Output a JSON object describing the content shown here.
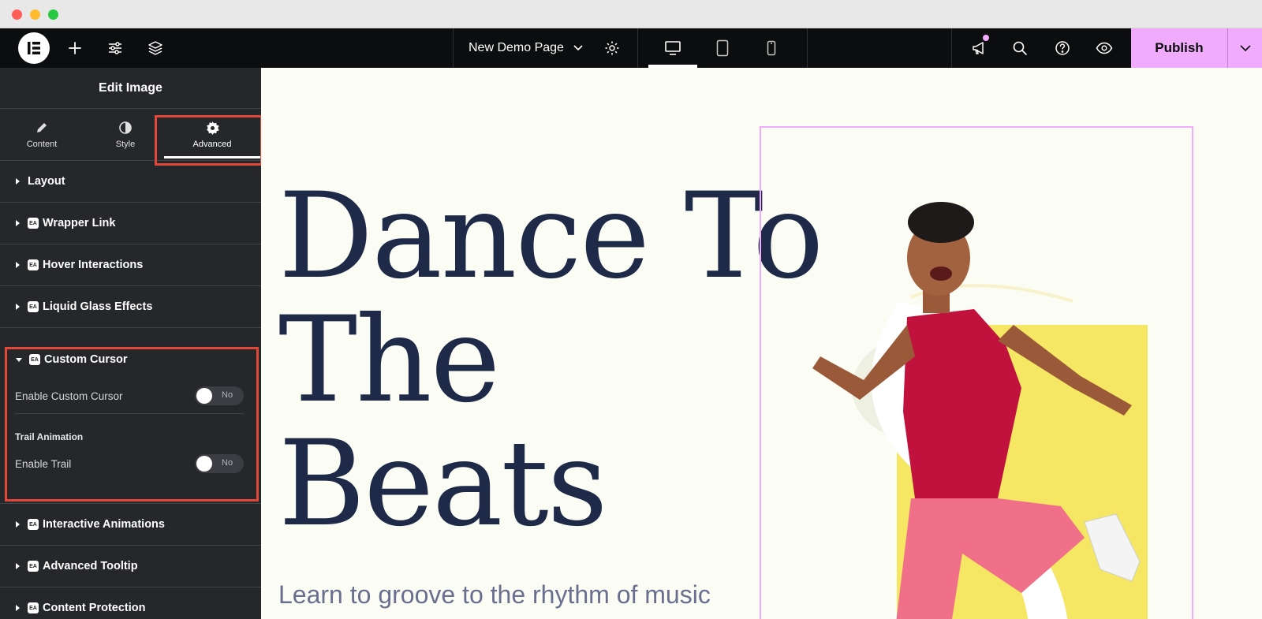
{
  "window": {
    "title": ""
  },
  "toolbar": {
    "page_name": "New Demo Page",
    "publish_label": "Publish",
    "icons": [
      "elementor-logo-icon",
      "add-icon",
      "sliders-icon",
      "layers-icon",
      "chevron-down-icon",
      "gear-icon",
      "desktop-icon",
      "tablet-icon",
      "mobile-icon",
      "megaphone-icon",
      "search-icon",
      "help-icon",
      "eye-icon"
    ]
  },
  "panel": {
    "title": "Edit Image",
    "tabs": [
      {
        "label": "Content",
        "icon": "pencil-icon"
      },
      {
        "label": "Style",
        "icon": "contrast-icon"
      },
      {
        "label": "Advanced",
        "icon": "gear-icon",
        "active": true
      }
    ],
    "sections_above": [
      {
        "label": "Layout",
        "badge": false
      },
      {
        "label": "Wrapper Link",
        "badge": true
      },
      {
        "label": "Hover Interactions",
        "badge": true
      },
      {
        "label": "Liquid Glass Effects",
        "badge": true
      }
    ],
    "custom_cursor": {
      "label": "Custom Cursor",
      "enable_label": "Enable Custom Cursor",
      "enable_value": "No",
      "trail_heading": "Trail Animation",
      "trail_label": "Enable Trail",
      "trail_value": "No"
    },
    "sections_below": [
      {
        "label": "Interactive Animations",
        "badge": true
      },
      {
        "label": "Advanced Tooltip",
        "badge": true
      },
      {
        "label": "Content Protection",
        "badge": true
      }
    ],
    "badge_text": "EA"
  },
  "canvas": {
    "headline_line1": "Dance To",
    "headline_line2": "The",
    "headline_line3": "Beats",
    "subtitle": "Learn to groove to the rhythm of music"
  },
  "colors": {
    "accent": "#f0abfc",
    "highlight": "#e1483a",
    "headline": "#1f2a48",
    "canvas_bg": "#fbfdf4",
    "panel_bg": "#26272b"
  }
}
